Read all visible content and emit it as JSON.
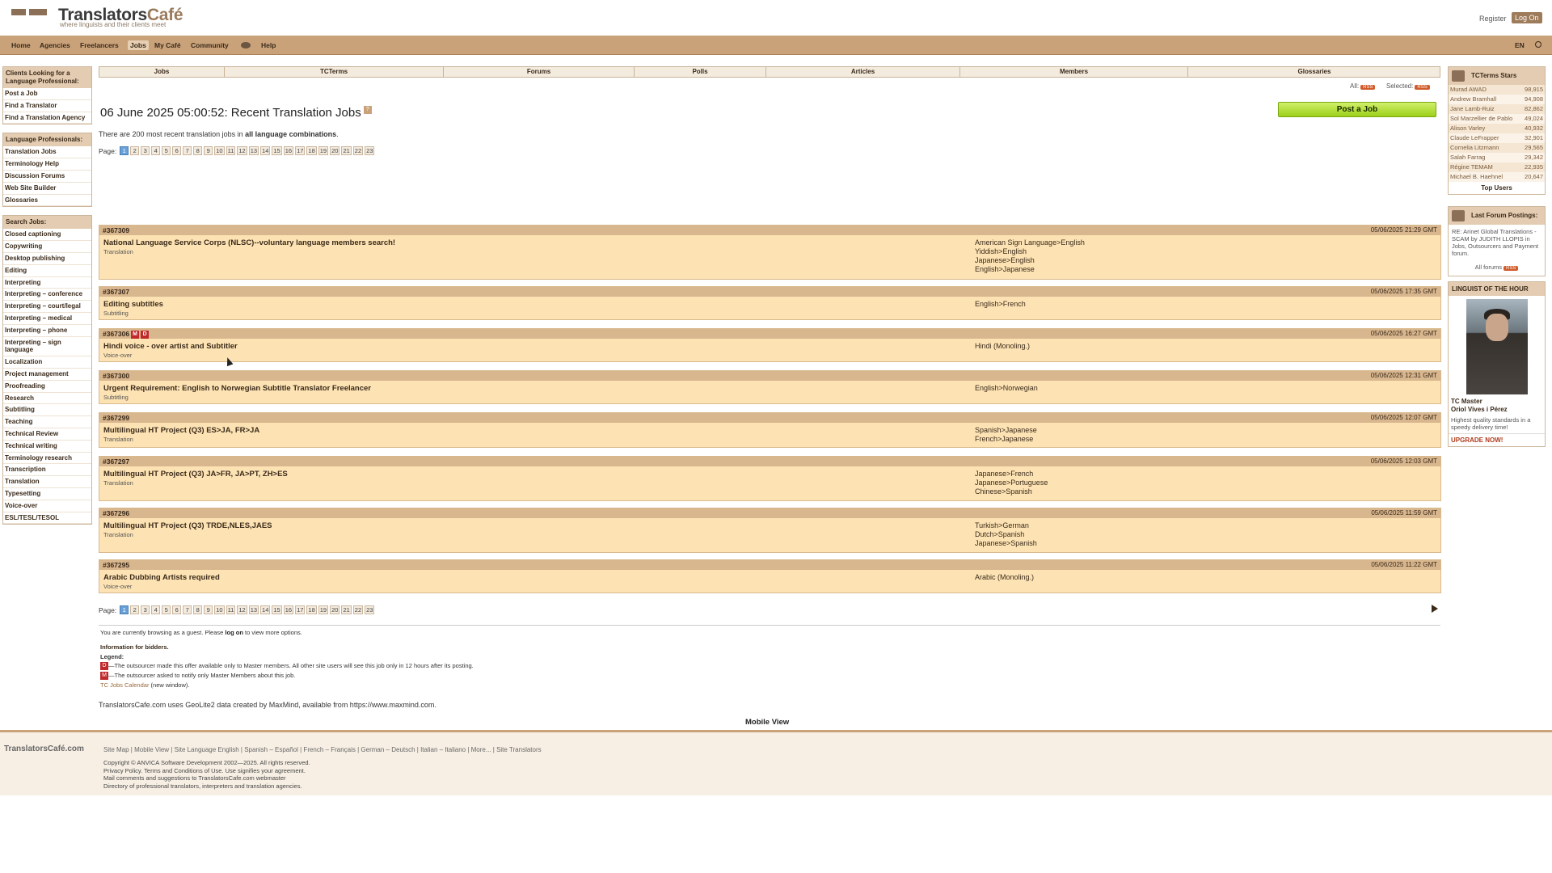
{
  "header": {
    "brand": "Translators",
    "brand_accent": "Café",
    "tagline": "where linguists and their clients meet",
    "register": "Register",
    "logon": "Log On"
  },
  "nav": {
    "items": [
      "Home",
      "Agencies",
      "Freelancers",
      "Jobs",
      "My Café",
      "Community",
      "Help"
    ],
    "active": "Jobs",
    "lang": "EN"
  },
  "left": {
    "clients_header": "Clients Looking for a Language Professional:",
    "clients_items": [
      "Post a Job",
      "Find a Translator",
      "Find a Translation Agency"
    ],
    "pros_header": "Language Professionals:",
    "pros_items": [
      "Translation Jobs",
      "Terminology Help",
      "Discussion Forums",
      "Web Site Builder",
      "Glossaries"
    ],
    "search_header": "Search Jobs:",
    "search_items": [
      "Closed captioning",
      "Copywriting",
      "Desktop publishing",
      "Editing",
      "Interpreting",
      "Interpreting – conference",
      "Interpreting – court/legal",
      "Interpreting – medical",
      "Interpreting – phone",
      "Interpreting – sign language",
      "Localization",
      "Project management",
      "Proofreading",
      "Research",
      "Subtitling",
      "Teaching",
      "Technical Review",
      "Technical writing",
      "Terminology research",
      "Transcription",
      "Translation",
      "Typesetting",
      "Voice-over",
      "ESL/TESL/TESOL"
    ]
  },
  "tabs": [
    "Jobs",
    "TCTerms",
    "Forums",
    "Polls",
    "Articles",
    "Members",
    "Glossaries"
  ],
  "rss": {
    "all": "All:",
    "selected": "Selected:",
    "badge": "RSS"
  },
  "main": {
    "title": "06 June 2025 05:00:52: Recent Translation Jobs",
    "summary_pre": "There are 200 most recent translation jobs in ",
    "summary_bold": "all language combinations",
    "summary_post": ".",
    "post_job": "Post a Job",
    "page_label": "Page:",
    "pages": [
      "1",
      "2",
      "3",
      "4",
      "5",
      "6",
      "7",
      "8",
      "9",
      "10",
      "11",
      "12",
      "13",
      "14",
      "15",
      "16",
      "17",
      "18",
      "19",
      "20",
      "21",
      "22",
      "23"
    ],
    "current_page": "1"
  },
  "jobs": [
    {
      "id": "#367309",
      "date": "05/06/2025 21:29 GMT",
      "title": "National Language Service Corps (NLSC)--voluntary language members search!",
      "category": "Translation",
      "pairs": [
        "American Sign Language>English",
        "Yiddish>English",
        "Japanese>English",
        "English>Japanese"
      ],
      "marks": []
    },
    {
      "id": "#367307",
      "date": "05/06/2025 17:35 GMT",
      "title": "Editing subtitles",
      "category": "Subtitling",
      "pairs": [
        "English>French"
      ],
      "marks": []
    },
    {
      "id": "#367306",
      "date": "05/06/2025 16:27 GMT",
      "title": "Hindi voice - over artist and Subtitler",
      "category": "Voice-over",
      "pairs": [
        "Hindi (Monoling.)"
      ],
      "marks": [
        "M",
        "D"
      ]
    },
    {
      "id": "#367300",
      "date": "05/06/2025 12:31 GMT",
      "title": "Urgent Requirement: English to Norwegian Subtitle Translator Freelancer",
      "category": "Subtitling",
      "pairs": [
        "English>Norwegian"
      ],
      "marks": []
    },
    {
      "id": "#367299",
      "date": "05/06/2025 12:07 GMT",
      "title": "Multilingual HT Project (Q3) ES>JA, FR>JA",
      "category": "Translation",
      "pairs": [
        "Spanish>Japanese",
        "French>Japanese"
      ],
      "marks": []
    },
    {
      "id": "#367297",
      "date": "05/06/2025 12:03 GMT",
      "title": "Multilingual HT Project (Q3) JA>FR, JA>PT, ZH>ES",
      "category": "Translation",
      "pairs": [
        "Japanese>French",
        "Japanese>Portuguese",
        "Chinese>Spanish"
      ],
      "marks": []
    },
    {
      "id": "#367296",
      "date": "05/06/2025 11:59 GMT",
      "title": "Multilingual HT Project (Q3) TRDE,NLES,JAES",
      "category": "Translation",
      "pairs": [
        "Turkish>German",
        "Dutch>Spanish",
        "Japanese>Spanish"
      ],
      "marks": []
    },
    {
      "id": "#367295",
      "date": "05/06/2025 11:22 GMT",
      "title": "Arabic Dubbing Artists required",
      "category": "Voice-over",
      "pairs": [
        "Arabic (Monoling.)"
      ],
      "marks": []
    }
  ],
  "bottom": {
    "guest_pre": "You are currently browsing as a guest. Please ",
    "guest_link": "log on",
    "guest_post": " to view more options.",
    "info": "Information for bidders.",
    "legend": "Legend:",
    "legend_d": "—The outsourcer made this offer available only to Master members. All other site users will see this job only in 12 hours after its posting.",
    "legend_m": "—The outsourcer asked to notify only Master Members about this job.",
    "calendar": "TC Jobs Calendar",
    "calendar_post": " (new window).",
    "maxmind": "TranslatorsCafe.com uses GeoLite2 data created by MaxMind, available from https://www.maxmind.com.",
    "mobile": "Mobile View"
  },
  "footer": {
    "brand": "TranslatorsCafé.com",
    "links": "Site Map  |  Mobile View  |  Site Language English  |  Spanish – Español  |  French – Français  |  German – Deutsch  |  Italian – Italiano  |  More...  |  Site Translators",
    "copy1": "Copyright © ANVICA Software Development 2002—2025. All rights reserved.",
    "copy2": "Privacy Policy. Terms and Conditions of Use. Use signifies your agreement.",
    "copy3": "Mail comments and suggestions to TranslatorsCafe.com webmaster",
    "copy4": "Directory of professional translators, interpreters and translation agencies."
  },
  "right": {
    "stars_title": "TCTerms Stars",
    "stars": [
      {
        "name": "Murad AWAD",
        "score": "98,915"
      },
      {
        "name": "Andrew Bramhall",
        "score": "94,908"
      },
      {
        "name": "Jane Lamb-Ruiz",
        "score": "82,862"
      },
      {
        "name": "Sol Marzellier de Pablo",
        "score": "49,024"
      },
      {
        "name": "Alison Varley",
        "score": "40,932"
      },
      {
        "name": "Claude LeFrapper",
        "score": "32,901"
      },
      {
        "name": "Cornelia Litzmann",
        "score": "29,565"
      },
      {
        "name": "Salah Farrag",
        "score": "29,342"
      },
      {
        "name": "Régine TEMAM",
        "score": "22,935"
      },
      {
        "name": "Michael B. Haehnel",
        "score": "20,647"
      }
    ],
    "top_users": "Top Users",
    "forum_title": "Last Forum Postings:",
    "forum_body": "RE: Arinet Global Translations - SCAM by JUDITH LLOPIS in Jobs, Outsourcers and Payment forum.",
    "all_forums": "All forums",
    "lohh_title": "LINGUIST OF THE HOUR",
    "lohh_role": "TC Master",
    "lohh_name": "Oriol Vives i Pérez",
    "lohh_desc": "Highest quality standards in a speedy delivery time!",
    "upgrade": "UPGRADE NOW!"
  }
}
